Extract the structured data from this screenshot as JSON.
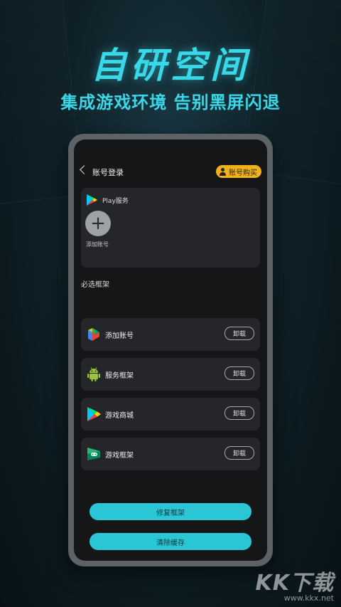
{
  "headline": "自研空间",
  "subheadline": "集成游戏环境 告别黑屏闪退",
  "app": {
    "title": "账号登录",
    "buy_button_label": "账号购买",
    "play_card": {
      "service_label": "Play服务",
      "add_account_label": "添加账号"
    },
    "section_label": "必选框架",
    "frameworks": [
      {
        "name": "添加账号",
        "icon": "play-services-icon",
        "action": "卸载"
      },
      {
        "name": "服务框架",
        "icon": "android-icon",
        "action": "卸载"
      },
      {
        "name": "游戏商城",
        "icon": "play-store-icon",
        "action": "卸载"
      },
      {
        "name": "游戏框架",
        "icon": "play-games-icon",
        "action": "卸载"
      }
    ],
    "repair_button_label": "修复框架",
    "clear_cache_button_label": "清除缓存"
  },
  "watermark": {
    "logo": "KK下载",
    "url": "www.kkx.net"
  },
  "colors": {
    "accent": "#38d8e8",
    "button": "#2bc6d6",
    "buy": "#f0b21c"
  }
}
